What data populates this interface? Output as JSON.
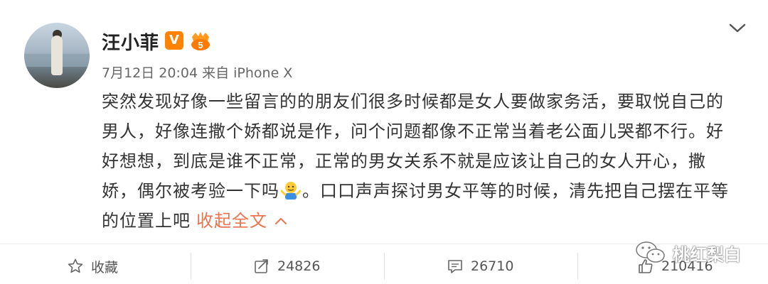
{
  "post": {
    "username": "汪小菲",
    "verified_badge": "V",
    "level_badge": "5",
    "timestamp": "7月12日 20:04",
    "source": "来自 iPhone X",
    "content_lines": [
      "突然发现好像一些留言的的朋友们很多时候都是女人要做家务活，要取悦自己的",
      "男人，好像连撒个娇都说是作，问个问题都像不正常当着老公面儿哭都不行。好",
      "好想想，到底是谁不正常，正常的男女关系不就是应该让自己的女人开心，撒",
      "娇，偶尔被考验一下吗",
      "。口口声声探讨男女平等的时候，清先把自己摆在平等",
      "的位置上吧"
    ],
    "collapse_label": "收起全文",
    "emoji": "shrug-emoji"
  },
  "actions": {
    "favorite_label": "收藏",
    "repost_count": "24826",
    "comment_count": "26710",
    "like_count": "210416"
  },
  "watermark": {
    "text": "桃红梨白"
  },
  "colors": {
    "accent": "#eb7350",
    "vip": "#ff8200",
    "text": "#333333",
    "meta": "#666666"
  },
  "icons": [
    "chevron-down-icon",
    "star-icon",
    "repost-icon",
    "comment-icon",
    "like-icon",
    "wechat-icon"
  ]
}
